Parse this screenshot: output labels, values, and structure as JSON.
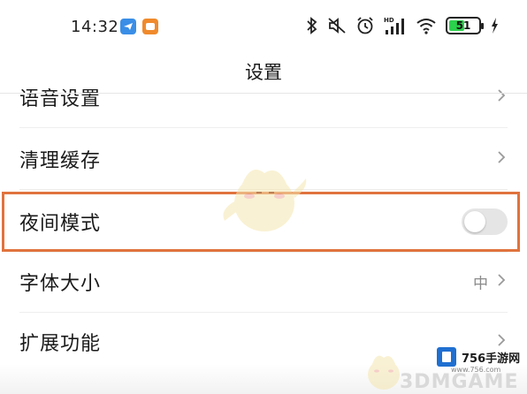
{
  "status_bar": {
    "time": "14:32",
    "icons": [
      "app-icon-blue",
      "app-icon-orange",
      "bluetooth-icon",
      "mute-icon",
      "alarm-icon",
      "hd-signal-icon",
      "wifi-icon",
      "battery-icon",
      "charging-icon"
    ],
    "signal_badge": "HD",
    "battery_level": "51",
    "battery_color": "#2bd24c"
  },
  "header": {
    "title": "设置"
  },
  "settings": {
    "items": [
      {
        "label": "语音设置"
      },
      {
        "label": "清理缓存"
      },
      {
        "label": "夜间模式",
        "toggle_on": false
      },
      {
        "label": "字体大小",
        "value": "中"
      },
      {
        "label": "扩展功能"
      }
    ]
  },
  "highlight_color": "#e0733e",
  "watermark": {
    "brand": "756手游网",
    "url": "www.756.com",
    "faint_text": "3DMGAME"
  }
}
